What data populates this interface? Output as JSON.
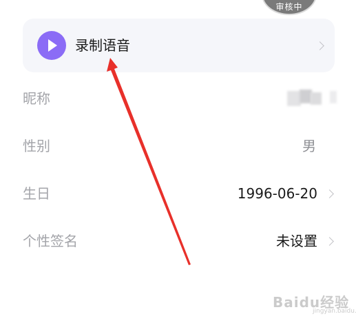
{
  "avatar": {
    "status_badge": "审核中"
  },
  "voice": {
    "label": "录制语音"
  },
  "profile_rows": [
    {
      "label": "昵称",
      "value": ""
    },
    {
      "label": "性别",
      "value": "男"
    },
    {
      "label": "生日",
      "value": "1996-06-20"
    },
    {
      "label": "个性签名",
      "value": "未设置"
    }
  ],
  "watermark": {
    "text": "Baidu经验",
    "sub": "jingyan.baidu.com"
  },
  "colors": {
    "accent_play": "#8b6cf6",
    "card_bg": "#f5f6fa",
    "label_gray": "#a3a4a9",
    "annotation_red": "#e8302a"
  },
  "icons": [
    "play-icon",
    "chevron-right-icon",
    "annotation-arrow"
  ]
}
